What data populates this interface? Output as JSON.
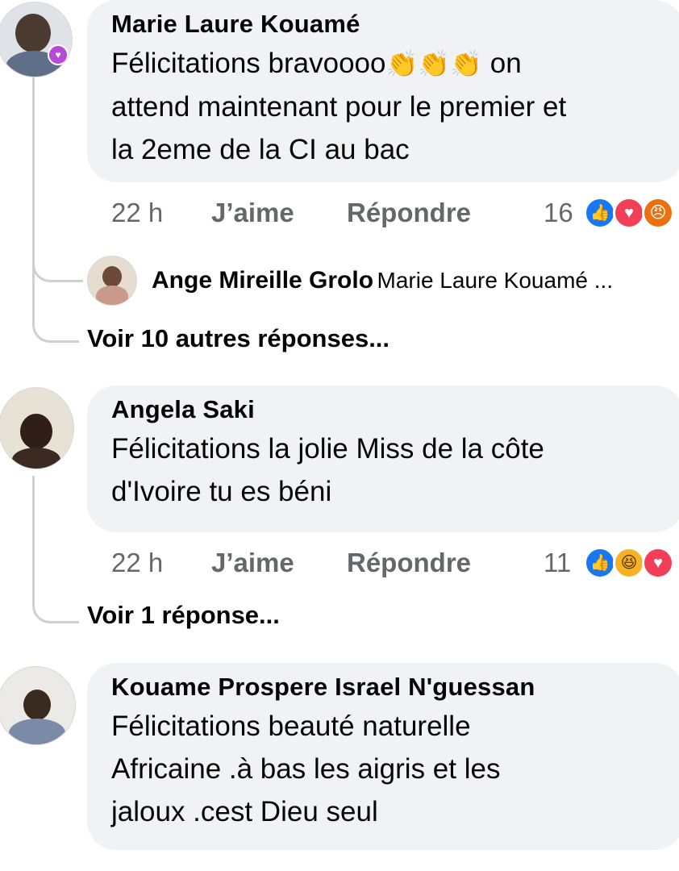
{
  "colors": {
    "bubble": "#f0f2f5",
    "meta": "#65676b",
    "like": "#1877f2",
    "love": "#f33e58",
    "angry": "#e9710f",
    "haha": "#f7b125"
  },
  "comments": [
    {
      "author": "Marie Laure Kouamé",
      "lines": [
        "Félicitations bravoooo",
        "on",
        "attend maintenant pour le premier et",
        "la 2eme de la CI  au bac"
      ],
      "emoji": "👏👏👏",
      "time": "22 h",
      "like_label": "J’aime",
      "reply_label": "Répondre",
      "reaction_count": "16",
      "reactions": [
        "like-icon",
        "love-icon",
        "angry-icon"
      ],
      "reply_preview": {
        "author": "Ange Mireille Grolo",
        "text": "Marie Laure Kouamé ..."
      },
      "more_replies": "Voir 10 autres réponses..."
    },
    {
      "author": "Angela Saki",
      "lines": [
        "Félicitations la jolie Miss de la côte",
        "d'Ivoire tu es béni"
      ],
      "time": "22 h",
      "like_label": "J’aime",
      "reply_label": "Répondre",
      "reaction_count": "11",
      "reactions": [
        "like-icon",
        "haha-icon",
        "love-icon"
      ],
      "more_replies": "Voir 1 réponse..."
    },
    {
      "author": "Kouame Prospere Israel N'guessan",
      "lines": [
        "Félicitations beauté naturelle",
        "Africaine .à bas les aigris et les",
        "jaloux .cest  Dieu seul"
      ]
    }
  ]
}
